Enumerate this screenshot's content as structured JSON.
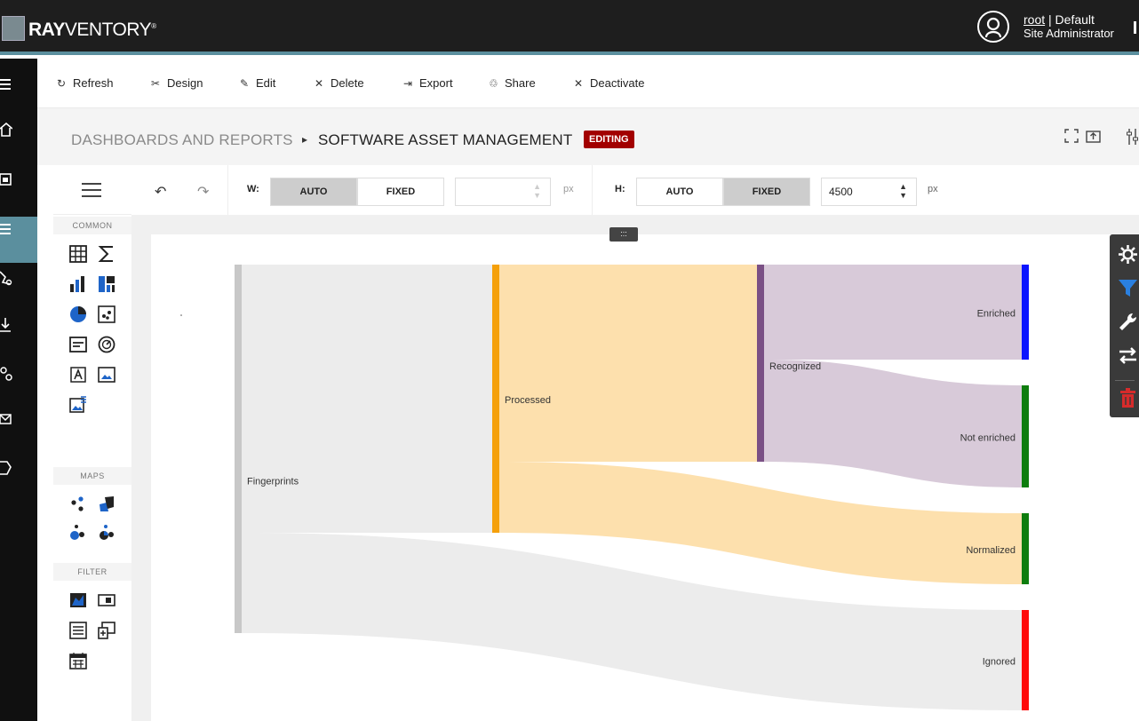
{
  "app": {
    "brand_bold": "RAY",
    "brand_rest": "VENTORY",
    "brand_mark": "®"
  },
  "user": {
    "name": "root",
    "separator": " | ",
    "scope": "Default",
    "role": "Site Administrator"
  },
  "toolbar": {
    "refresh": "Refresh",
    "design": "Design",
    "edit": "Edit",
    "delete": "Delete",
    "export": "Export",
    "share": "Share",
    "deactivate": "Deactivate"
  },
  "breadcrumb": {
    "root": "DASHBOARDS AND REPORTS",
    "separator": "▸",
    "current": "SOFTWARE ASSET MANAGEMENT",
    "badge": "EDITING"
  },
  "palette": {
    "sections": [
      "COMMON",
      "MAPS",
      "FILTER"
    ]
  },
  "sizing": {
    "width_label": "W:",
    "height_label": "H:",
    "auto_label": "AUTO",
    "fixed_label": "FIXED",
    "width_mode": "AUTO",
    "height_mode": "FIXED",
    "width_value": "",
    "height_value": "4500",
    "unit": "px"
  },
  "chart_data": {
    "type": "sankey",
    "nodes": [
      "Fingerprints",
      "Processed",
      "Recognized",
      "Enriched",
      "Not enriched",
      "Normalized",
      "Ignored"
    ],
    "links": [
      {
        "source": "Fingerprints",
        "target": "Processed",
        "value": 302
      },
      {
        "source": "Fingerprints",
        "target": "Ignored",
        "value": 113
      },
      {
        "source": "Processed",
        "target": "Recognized",
        "value": 222
      },
      {
        "source": "Processed",
        "target": "Normalized",
        "value": 80
      },
      {
        "source": "Recognized",
        "target": "Enriched",
        "value": 107
      },
      {
        "source": "Recognized",
        "target": "Not enriched",
        "value": 115
      }
    ],
    "colors": {
      "Fingerprints": "#c8c8c8",
      "Processed": "#f5a00a",
      "Recognized": "#7a5085",
      "Enriched": "#0a14ff",
      "Not enriched": "#0e7d0e",
      "Normalized": "#0e7d0e",
      "Ignored": "#ff0a0a"
    }
  }
}
